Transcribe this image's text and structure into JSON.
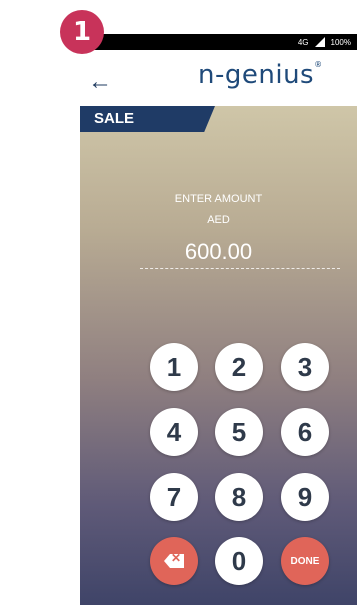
{
  "step_badge": "1",
  "status_bar": {
    "network": "4G",
    "battery": "100%",
    "signal_icon": "signal-icon"
  },
  "app_bar": {
    "back_icon": "←",
    "logo_text": "n-genius",
    "logo_mark": "®"
  },
  "transaction": {
    "tab_label": "SALE",
    "amount_label": "ENTER AMOUNT",
    "currency": "AED",
    "amount": "600.00"
  },
  "keypad": {
    "keys": [
      "1",
      "2",
      "3",
      "4",
      "5",
      "6",
      "7",
      "8",
      "9"
    ],
    "zero": "0",
    "done_label": "DONE",
    "delete_icon": "backspace-icon"
  },
  "colors": {
    "badge": "#c8335a",
    "tab": "#1f3b66",
    "action_key": "#e06559",
    "logo": "#1f4a7a"
  }
}
